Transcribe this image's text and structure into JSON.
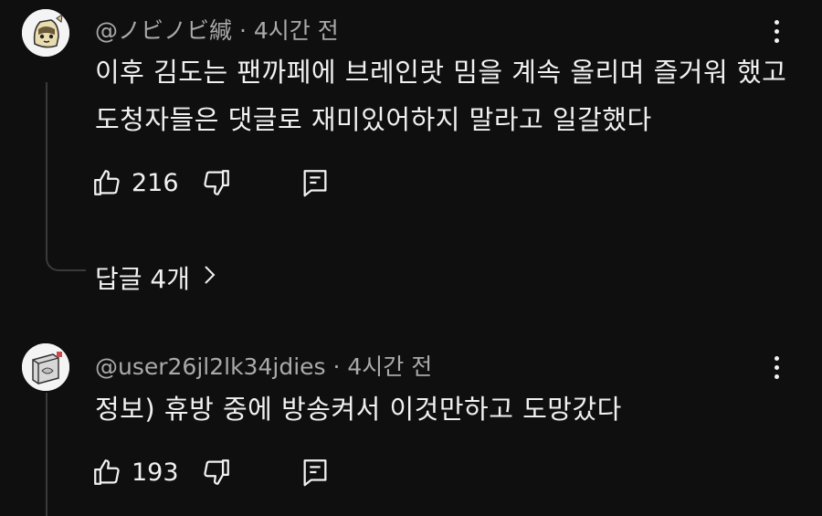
{
  "comments": [
    {
      "handle": "@ノビノビ緘",
      "time": "4시간 전",
      "lines": [
        "이후 김도는 팬까페에 브레인랏 밈을 계속 올리며 즐거워 했고",
        "도청자들은 댓글로 재미있어하지 말라고 일갈했다"
      ],
      "likes": "216",
      "replies_label": "답글 4개"
    },
    {
      "handle": "@user26jl2lk34jdies",
      "time": "4시간 전",
      "lines": [
        "정보) 휴방 중에 방송켜서 이것만하고 도망갔다"
      ],
      "likes": "193"
    }
  ],
  "separator": "·",
  "icons": {
    "like": "thumbs-up-icon",
    "dislike": "thumbs-down-icon",
    "reply": "reply-icon",
    "more": "more-vert-icon",
    "chevron": "chevron-right-icon"
  },
  "colors": {
    "background": "#0f0f0f",
    "text": "#f1f1f1",
    "meta": "#aaaaaa",
    "thread": "#3a3a3a"
  }
}
